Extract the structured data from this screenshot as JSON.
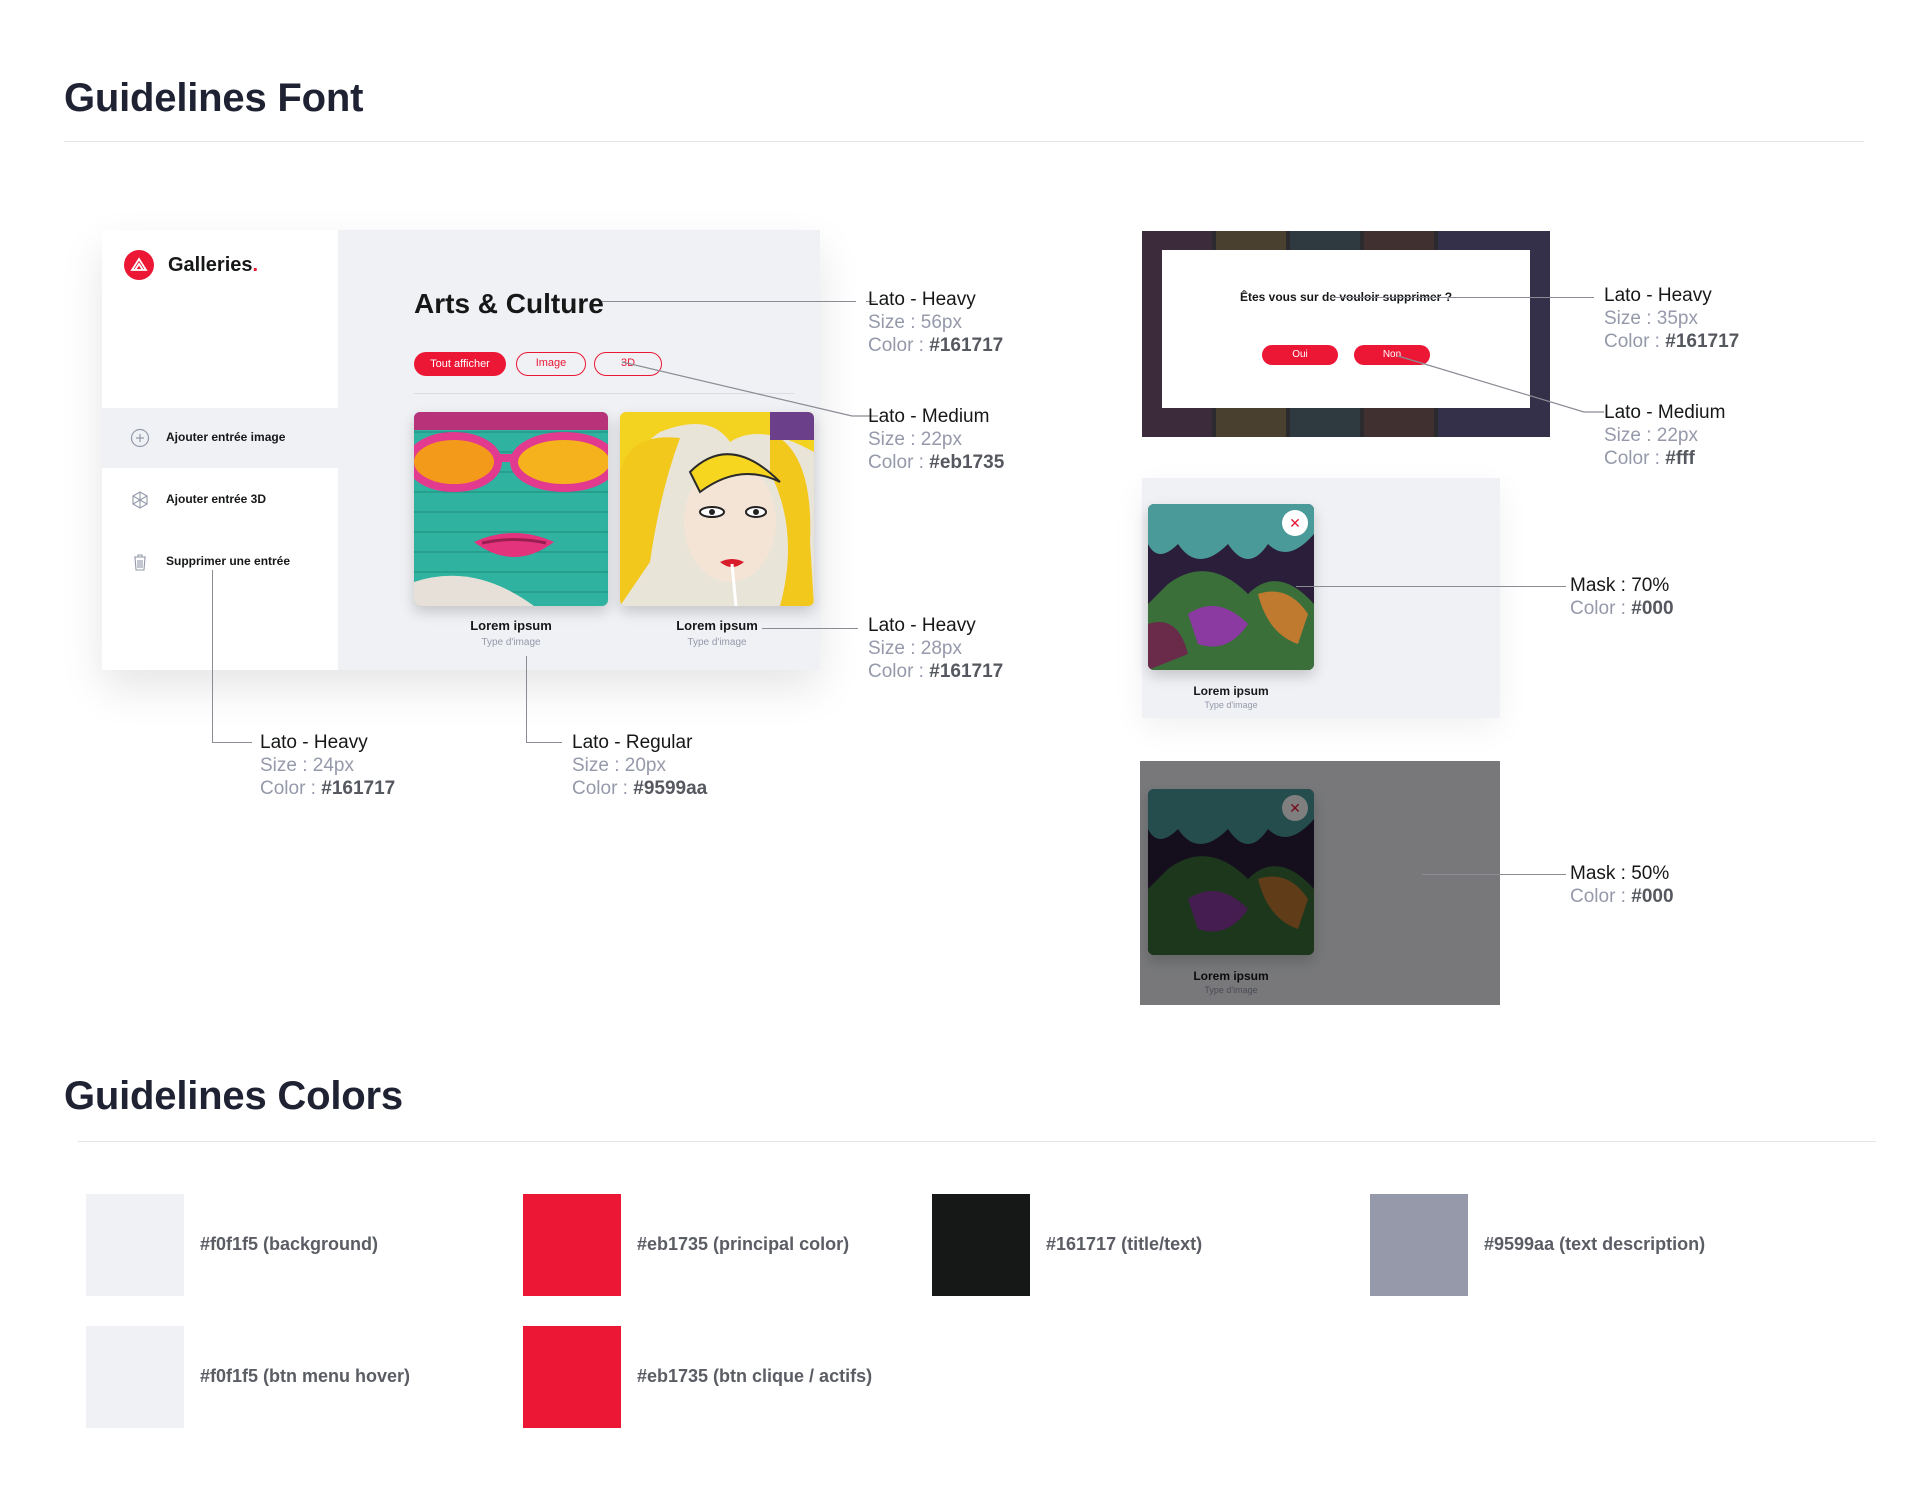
{
  "sections": {
    "font_title": "Guidelines Font",
    "colors_title": "Guidelines Colors"
  },
  "app": {
    "brand": "Galleries",
    "brand_dot": ".",
    "page_title": "Arts & Culture",
    "filters": [
      "Tout afficher",
      "Image",
      "3D"
    ],
    "active_filter": "Tout afficher",
    "menu": [
      {
        "label": "Ajouter entrée image",
        "icon": "plus-circle-icon",
        "hover": true
      },
      {
        "label": "Ajouter entrée 3D",
        "icon": "cube-icon",
        "hover": false
      },
      {
        "label": "Supprimer une entrée",
        "icon": "trash-icon",
        "hover": false
      }
    ],
    "cards": [
      {
        "title": "Lorem ipsum",
        "subtitle": "Type d'image"
      },
      {
        "title": "Lorem ipsum",
        "subtitle": "Type d'image"
      }
    ]
  },
  "dialog": {
    "question": "Êtes vous sur de vouloir supprimer ?",
    "yes": "Oui",
    "no": "Non"
  },
  "mask_cards": [
    {
      "title": "Lorem ipsum",
      "subtitle": "Type d'image"
    },
    {
      "title": "Lorem ipsum",
      "subtitle": "Type d'image"
    }
  ],
  "annotations": {
    "title": {
      "font": "Lato - Heavy",
      "size": "Size : 56px",
      "color_prefix": "Color : ",
      "color": "#161717"
    },
    "filter": {
      "font": "Lato - Medium",
      "size": "Size : 22px",
      "color_prefix": "Color : ",
      "color": "#eb1735"
    },
    "card_title": {
      "font": "Lato - Heavy",
      "size": "Size : 28px",
      "color_prefix": "Color : ",
      "color": "#161717"
    },
    "menu": {
      "font": "Lato - Heavy",
      "size": "Size : 24px",
      "color_prefix": "Color : ",
      "color": "#161717"
    },
    "card_sub": {
      "font": "Lato - Regular",
      "size": "Size : 20px",
      "color_prefix": "Color : ",
      "color": "#9599aa"
    },
    "dialog_q": {
      "font": "Lato - Heavy",
      "size": "Size : 35px",
      "color_prefix": "Color : ",
      "color": "#161717"
    },
    "dialog_btn": {
      "font": "Lato - Medium",
      "size": "Size : 22px",
      "color_prefix": "Color : ",
      "color": "#fff"
    },
    "mask70": {
      "font": "Mask : 70%",
      "color_prefix": "Color : ",
      "color": "#000"
    },
    "mask50": {
      "font": "Mask : 50%",
      "color_prefix": "Color : ",
      "color": "#000"
    }
  },
  "colors": [
    {
      "hex": "#f0f1f5",
      "label": "#f0f1f5 (background)"
    },
    {
      "hex": "#eb1735",
      "label": "#eb1735 (principal color)"
    },
    {
      "hex": "#161717",
      "label": "#161717 (title/text)"
    },
    {
      "hex": "#9599aa",
      "label": "#9599aa (text description)"
    },
    {
      "hex": "#f0f1f5",
      "label": "#f0f1f5 (btn menu hover)"
    },
    {
      "hex": "#eb1735",
      "label": "#eb1735 (btn clique / actifs)"
    }
  ]
}
